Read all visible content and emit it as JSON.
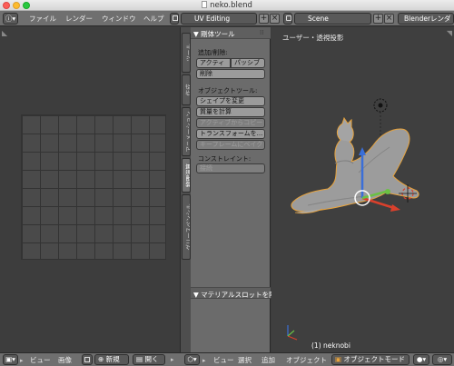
{
  "window": {
    "title": "neko.blend"
  },
  "topbar": {
    "info_icon": "info-icon",
    "menu": {
      "file": "ファイル",
      "render": "レンダー",
      "window": "ウィンドウ",
      "help": "ヘルプ"
    },
    "screen_layout": "UV Editing",
    "scene": "Scene",
    "render_engine": "Blenderレンダー"
  },
  "shelf": {
    "tabs": [
      "ツール",
      "作成",
      "アニメーション",
      "物理演算",
      "グリースペンシル"
    ],
    "panel_title": "▼ 剛体ツール",
    "add_remove_label": "追加/削除:",
    "active_btn": "アクティ",
    "passive_btn": "パッシブ",
    "remove_btn": "削除",
    "object_tools_label": "オブジェクトツール:",
    "change_shape_btn": "シェイプを変更",
    "calc_mass_btn": "質量を計算",
    "copy_from_active_btn": "アクティブからコピー",
    "apply_transform_btn": "トランスフォームを...",
    "bake_to_keyframes_btn": "キーフレームにベイク",
    "constraints_label": "コンストレイント:",
    "connect_btn": "接続",
    "material_slot_panel": "▼ マテリアルスロットを除"
  },
  "viewport": {
    "view_label": "ユーザー・透視投影",
    "object_label": "(1) neknobi"
  },
  "bottombar": {
    "uv": {
      "view": "ビュー",
      "image": "画像",
      "new": "新規",
      "open": "開く"
    },
    "view3d": {
      "view": "ビュー",
      "select": "選択",
      "add": "追加",
      "object": "オブジェクト",
      "mode": "オブジェクトモード"
    }
  },
  "colors": {
    "selected_outline": "#e8a33c",
    "x_axis": "#d9402c",
    "y_axis": "#6bc044",
    "z_axis": "#3a6fd8"
  }
}
